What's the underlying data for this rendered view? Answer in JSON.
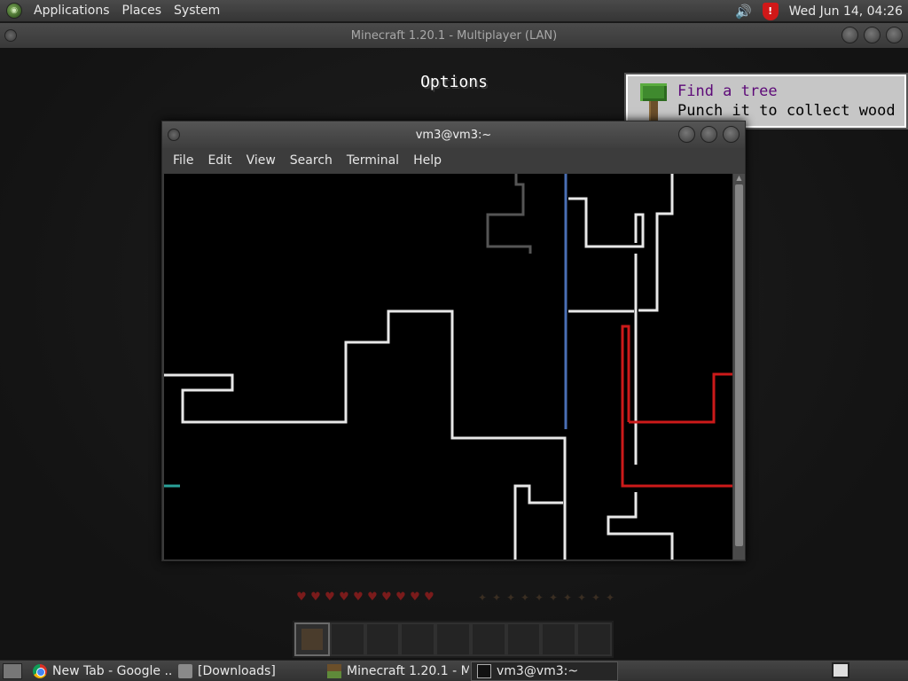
{
  "top_panel": {
    "menus": [
      "Applications",
      "Places",
      "System"
    ],
    "clock": "Wed Jun 14, 04:26",
    "icons": [
      "volume-icon",
      "security-shield-icon"
    ]
  },
  "minecraft_window": {
    "title": "Minecraft 1.20.1 - Multiplayer (LAN)",
    "screen_title": "Options",
    "toast": {
      "title": "Find a tree",
      "description": "Punch it to collect wood",
      "icon": "tree-icon"
    },
    "hud": {
      "hearts": 10,
      "food": 10,
      "hotbar_slots": 9,
      "selected_slot": 1
    }
  },
  "terminal_window": {
    "title": "vm3@vm3:~",
    "menu": [
      "File",
      "Edit",
      "View",
      "Search",
      "Terminal",
      "Help"
    ],
    "colors": {
      "background": "#000000",
      "white": "#e8e8e8",
      "red": "#cc1a1a",
      "blue": "#4a6fb5",
      "gray": "#555555",
      "teal": "#2aa198"
    }
  },
  "taskbar": {
    "tasks": [
      {
        "label": "New Tab - Google ...",
        "icon": "chrome-icon",
        "active": false
      },
      {
        "label": "[Downloads]",
        "icon": "folder-icon",
        "active": false
      },
      {
        "label": "Minecraft 1.20.1 - M...",
        "icon": "minecraft-icon",
        "active": false
      },
      {
        "label": "vm3@vm3:~",
        "icon": "terminal-icon",
        "active": true
      }
    ]
  }
}
